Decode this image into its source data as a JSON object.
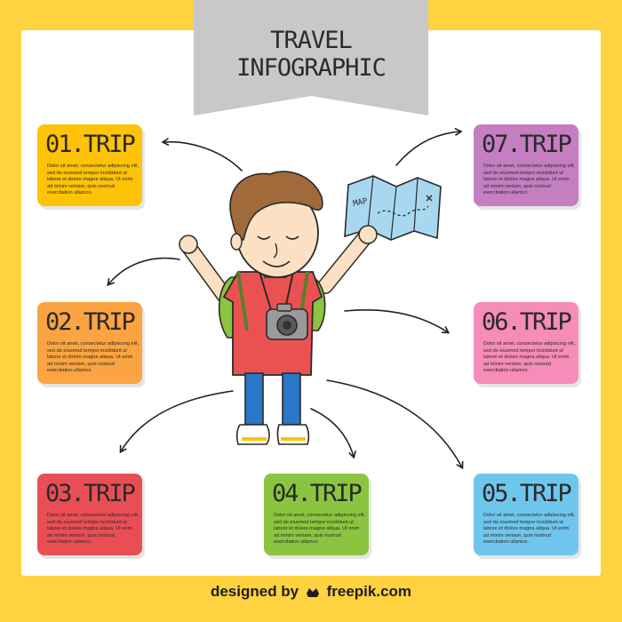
{
  "title": "TRAVEL INFOGRAPHIC",
  "cards": [
    {
      "id": "trip-01",
      "label": "01.TRIP",
      "color": "#fec307",
      "text": "Dolor sit amet, consectetur adipiscing elit, sed do eiusmod tempor incididunt ut labore et dolore magna aliqua. Ut enim ad minim veniam, quis nostrud exercitation ullamco."
    },
    {
      "id": "trip-02",
      "label": "02.TRIP",
      "color": "#fba441",
      "text": "Dolor sit amet, consectetur adipiscing elit, sed do eiusmod tempor incididunt ut labore et dolore magna aliqua. Ut enim ad minim veniam, quis nostrud exercitation ullamco."
    },
    {
      "id": "trip-03",
      "label": "03.TRIP",
      "color": "#ea4e55",
      "text": "Dolor sit amet, consectetur adipiscing elit, sed do eiusmod tempor incididunt ut labore et dolore magna aliqua. Ut enim ad minim veniam, quis nostrud exercitation ullamco."
    },
    {
      "id": "trip-04",
      "label": "04.TRIP",
      "color": "#8bc53f",
      "text": "Dolor sit amet, consectetur adipiscing elit, sed do eiusmod tempor incididunt ut labore et dolore magna aliqua. Ut enim ad minim veniam, quis nostrud exercitation ullamco."
    },
    {
      "id": "trip-05",
      "label": "05.TRIP",
      "color": "#6fc6ec",
      "text": "Dolor sit amet, consectetur adipiscing elit, sed do eiusmod tempor incididunt ut labore et dolore magna aliqua. Ut enim ad minim veniam, quis nostrud exercitation ullamco."
    },
    {
      "id": "trip-06",
      "label": "06.TRIP",
      "color": "#f68cb8",
      "text": "Dolor sit amet, consectetur adipiscing elit, sed do eiusmod tempor incididunt ut labore et dolore magna aliqua. Ut enim ad minim veniam, quis nostrud exercitation ullamco."
    },
    {
      "id": "trip-07",
      "label": "07.TRIP",
      "color": "#c57ec2",
      "text": "Dolor sit amet, consectetur adipiscing elit, sed do eiusmod tempor incididunt ut labore et dolore magna aliqua. Ut enim ad minim veniam, quis nostrud exercitation ullamco."
    }
  ],
  "map_label": "MAP",
  "footer": {
    "prefix": "designed by",
    "brand": "freepik.com"
  },
  "colors": {
    "frame": "#ffd23f",
    "banner": "#c8c8c8",
    "shirt": "#ea5252",
    "pants": "#2a76c9",
    "backpack": "#8bc53f",
    "hair": "#a06a3b",
    "map": "#a8d8f0"
  }
}
